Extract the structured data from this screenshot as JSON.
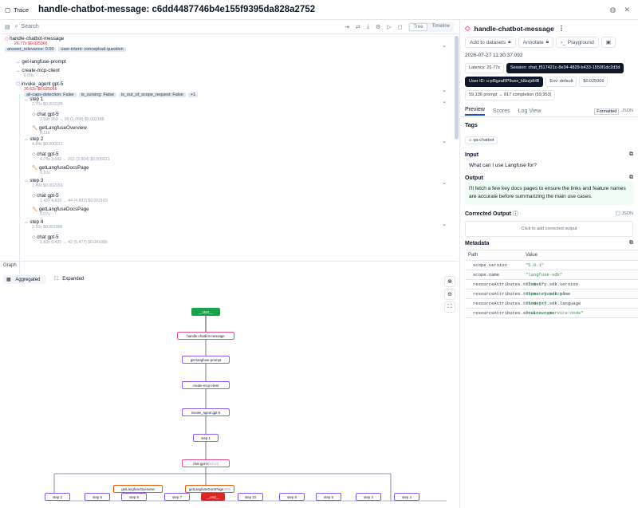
{
  "topbar": {
    "label": "Trace",
    "title": "handle-chatbot-message: c6dd4487746b4e155f9395da828a2752"
  },
  "search": {
    "placeholder": "Search"
  },
  "views": {
    "tree": "Tree",
    "timeline": "Timeline"
  },
  "tree": {
    "root": {
      "name": "handle-chatbot-message",
      "latency": "26.77s",
      "cost": "$0.025066",
      "scores": [
        "answer_relevance: 0.00",
        "user-intent: conceptual-question"
      ]
    },
    "n1": {
      "name": "get-langfuse-prompt"
    },
    "n2": {
      "name": "create-mcp-client",
      "latency": "0.09s"
    },
    "n3": {
      "name": "invoke_agent gpt-5",
      "latency": "26.62s",
      "cost": "$0.025066",
      "scores": [
        "ali-caps-detection: False",
        "is_cursing: False",
        "is_out_of_scope_request: False",
        "+1"
      ]
    },
    "steps": [
      {
        "name": "step 1",
        "meta": "2.70s  $0.002189",
        "chat": "chat gpt-5",
        "chat_meta": "2.59s  959 → 99 (1,058)  $0.002189",
        "tool": "getLangfuseOverview",
        "tool_meta": "0.11s"
      },
      {
        "name": "step 2",
        "meta": "4.84s  $0.006021",
        "chat": "chat gpt-5",
        "chat_meta": "4.74s  3,642 → 262 (3,904)  $0.006021",
        "tool": "getLangfuseDocsPage",
        "tool_meta": "0.10s"
      },
      {
        "name": "step 3",
        "meta": "1.49s  $0.002169",
        "chat": "chat gpt-5",
        "chat_meta": "1.42s  4,839 → 44 (4,883)  $0.002169",
        "tool": "getLangfuseDocsPage",
        "tool_meta": "0.07s"
      },
      {
        "name": "step 4",
        "meta": "2.10s  $0.001886",
        "chat": "chat gpt-5",
        "chat_meta": "1.83s  5,435 → 42 (5,477)  $0.001886"
      }
    ]
  },
  "graph": {
    "label": "Graph",
    "tab_aggregated": "Aggregated",
    "tab_expanded": "Expanded",
    "nodes": {
      "start": "__start__",
      "handle": "handle-chatbot-message",
      "prompt": "get-langfuse-prompt",
      "mcp": "create-mcp-client",
      "agent": "invoke_agent gpt-5",
      "step1": "step 1",
      "chat": "chat gpt-5",
      "chat_count": "(10/10)",
      "overview": "getLangfuseOverview",
      "docs": "getLangfuseDocsPage",
      "docs_count": "(9/9)",
      "end": "__end__"
    },
    "bottom": [
      "step 2",
      "step 6",
      "step 9",
      "step 7",
      "step 10",
      "step 8",
      "step 5",
      "step 3",
      "step 4"
    ]
  },
  "panel": {
    "title": "handle-chatbot-message",
    "add": "Add to datasets",
    "annotate": "Annotate",
    "playground": "Playground",
    "timestamp": "2026-07-27 11:30:37.092",
    "badges": [
      "Latency: 26.77s",
      "Session: chat_f517421c-8e34-4829-b433-1550f1dc2d3d",
      "User ID: u-pl5gzaRP9uxx_k8zzjdHB",
      "Env: default",
      "$0.025066",
      "59,136 prompt → 817 completion (59,953)"
    ],
    "tabs": [
      "Preview",
      "Scores",
      "Log View"
    ],
    "format_on": "Formatted",
    "format_off": "JSON",
    "tags_label": "Tags",
    "tag": "qa-chatbot",
    "input_label": "Input",
    "input": "What can I use Langfuse for?",
    "output_label": "Output",
    "output": "I'll fetch a few key docs pages to ensure the links and feature names are accurate before summarizing the main use cases.",
    "corrected_label": "Corrected Output",
    "corrected_json": "JSON",
    "corrected_placeholder": "Click to add corrected output",
    "metadata_label": "Metadata",
    "col_path": "Path",
    "col_value": "Value",
    "meta": [
      {
        "k": "scope.version",
        "v": "\"5.9.1\""
      },
      {
        "k": "scope.name",
        "v": "\"langfuse-sdk\""
      },
      {
        "k": "resourceAttributes.telemetry.sdk.version",
        "v": "\"2.0.1\""
      },
      {
        "k": "resourceAttributes.telemetry.sdk.name",
        "v": "\"opentelemetry\""
      },
      {
        "k": "resourceAttributes.telemetry.sdk.language",
        "v": "\"nodejs\""
      },
      {
        "k": "resourceAttributes.service.name",
        "v": "\"unknown_service:node\""
      }
    ]
  },
  "colors": {
    "accent": "#1d4ed8",
    "trace": "#ec4899",
    "tool": "#ea580c",
    "agent": "#8b5cf6",
    "green": "#16a34a",
    "end": "#dc2626"
  }
}
